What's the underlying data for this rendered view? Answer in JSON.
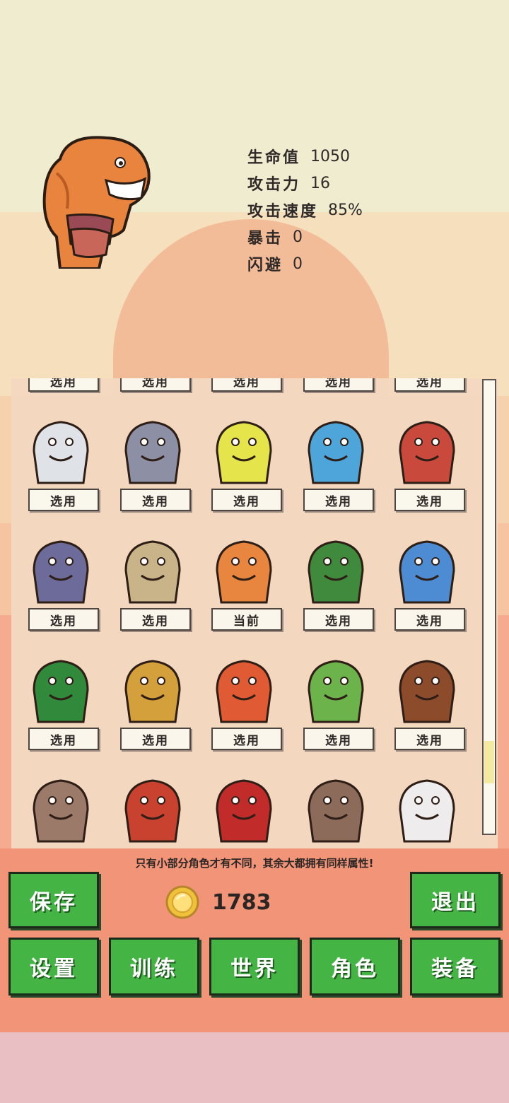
{
  "hero": {
    "name_icon": "clay-golem-hero",
    "stats": [
      {
        "label": "生命值",
        "value": "1050"
      },
      {
        "label": "攻击力",
        "value": "16"
      },
      {
        "label": "攻击速度",
        "value": "85%"
      },
      {
        "label": "暴击",
        "value": "0"
      },
      {
        "label": "闪避",
        "value": "0"
      }
    ]
  },
  "roster": {
    "rows": [
      {
        "cells": [
          {
            "icon": "purple-monster-icon",
            "button": "选用"
          },
          {
            "icon": "green-monster-icon",
            "button": "选用"
          },
          {
            "icon": "purple-blob-icon",
            "button": "选用"
          },
          {
            "icon": "red-beast-icon",
            "button": "选用"
          },
          {
            "icon": "brown-beast-icon",
            "button": "选用"
          }
        ]
      },
      {
        "cells": [
          {
            "icon": "white-werewolf-icon",
            "button": "选用"
          },
          {
            "icon": "vampire-icon",
            "button": "选用"
          },
          {
            "icon": "yellow-turtle-icon",
            "button": "选用"
          },
          {
            "icon": "blue-shark-icon",
            "button": "选用"
          },
          {
            "icon": "red-bear-icon",
            "button": "选用"
          }
        ]
      },
      {
        "cells": [
          {
            "icon": "beholder-icon",
            "button": "选用"
          },
          {
            "icon": "skeleton-knight-icon",
            "button": "选用"
          },
          {
            "icon": "clay-golem-icon",
            "button": "当前"
          },
          {
            "icon": "green-gargoyle-icon",
            "button": "选用"
          },
          {
            "icon": "blue-fish-demon-icon",
            "button": "选用"
          }
        ]
      },
      {
        "cells": [
          {
            "icon": "frog-king-icon",
            "button": "选用"
          },
          {
            "icon": "armored-dog-icon",
            "button": "选用"
          },
          {
            "icon": "red-dragon-icon",
            "button": "选用"
          },
          {
            "icon": "goblin-boar-rider-icon",
            "button": "选用"
          },
          {
            "icon": "minotaur-icon",
            "button": "选用"
          }
        ]
      },
      {
        "cells": [
          {
            "icon": "rock-golem-icon"
          },
          {
            "icon": "crocodile-warrior-icon"
          },
          {
            "icon": "red-demon-girl-icon"
          },
          {
            "icon": "stone-troll-icon"
          },
          {
            "icon": "chicken-fighter-icon"
          }
        ]
      }
    ]
  },
  "hint": "只有小部分角色才有不同，其余大都拥有同样属性!",
  "coins": "1783",
  "buttons": {
    "save": "保存",
    "exit": "退出",
    "settings": "设置",
    "train": "训练",
    "world": "世界",
    "character": "角色",
    "equipment": "装备"
  },
  "colors": {
    "button_green": "#44b544",
    "coin_gold": "#f0c23a"
  }
}
